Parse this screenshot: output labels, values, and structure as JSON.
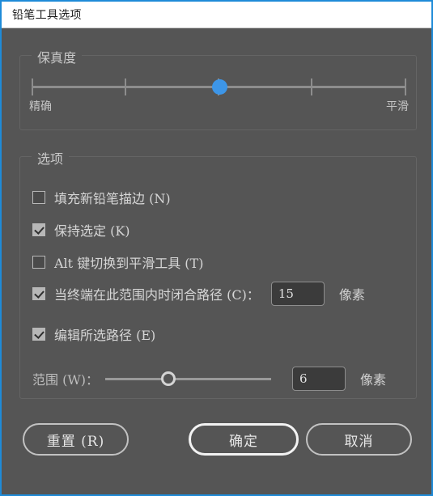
{
  "window": {
    "title": "铅笔工具选项",
    "accent_color": "#1e8bd8",
    "background_color": "#555555",
    "titlebar_color": "#ffffff"
  },
  "fidelity": {
    "legend": "保真度",
    "left_label": "精确",
    "right_label": "平滑",
    "tick_count": 5,
    "value_percent": 50,
    "handle_color": "#3d96e8"
  },
  "options": {
    "legend": "选项",
    "items": [
      {
        "label": "填充新铅笔描边 (N)",
        "checked": false
      },
      {
        "label": "保持选定 (K)",
        "checked": true
      },
      {
        "label": "Alt 键切换到平滑工具 (T)",
        "checked": false
      },
      {
        "label": "当终端在此范围内时闭合路径 (C)：",
        "checked": true
      },
      {
        "label": "编辑所选路径 (E)",
        "checked": true
      }
    ],
    "close_path": {
      "value": "15",
      "unit": "像素"
    },
    "width": {
      "label": "范围 (W)：",
      "value": "6",
      "unit": "像素",
      "slider_percent": 38
    }
  },
  "buttons": {
    "reset": "重置 (R)",
    "ok": "确定",
    "cancel": "取消"
  }
}
